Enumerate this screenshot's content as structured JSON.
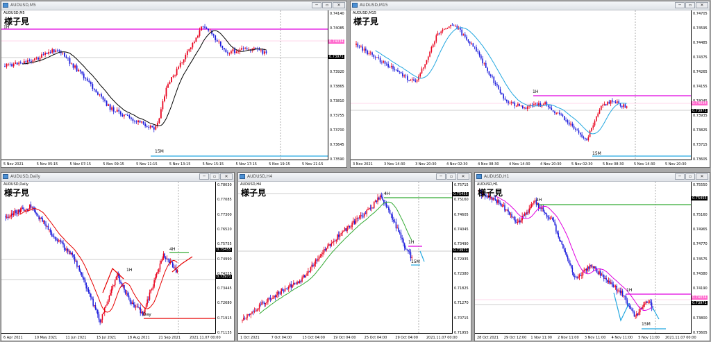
{
  "windows": [
    {
      "id": "w1",
      "title": "AUDUSD,M5",
      "symbol_line": "AUDUSD,M5",
      "note": "様子見",
      "y_ticks": [
        "0.74140",
        "0.74085",
        "0.74030",
        "0.73975",
        "0.73920",
        "0.73865",
        "0.73810",
        "0.73755",
        "0.73700",
        "0.73645",
        "0.73590"
      ],
      "x_ticks": [
        "5 Nov 2021",
        "5 Nov 05:15",
        "5 Nov 07:15",
        "5 Nov 09:15",
        "5 Nov 11:15",
        "5 Nov 13:15",
        "5 Nov 15:15",
        "5 Nov 17:15",
        "5 Nov 19:15",
        "5 Nov 21:15"
      ],
      "price_tags": [
        {
          "text": "0.74034",
          "color": "#ff66cc"
        },
        {
          "text": "0.73971",
          "color": "#000000"
        }
      ],
      "annotations": [
        "1H",
        "15M"
      ]
    },
    {
      "id": "w2",
      "title": "AUDUSD,M15",
      "symbol_line": "AUDUSD,M15",
      "note": "様子見",
      "y_ticks": [
        "0.74705",
        "0.74595",
        "0.74485",
        "0.74375",
        "0.74265",
        "0.74155",
        "0.74045",
        "0.73935",
        "0.73825",
        "0.73715",
        "0.73605"
      ],
      "x_ticks": [
        "3 Nov 2021",
        "3 Nov 14:30",
        "3 Nov 20:30",
        "4 Nov 02:30",
        "4 Nov 08:30",
        "4 Nov 14:30",
        "4 Nov 20:30",
        "5 Nov 02:30",
        "5 Nov 08:30",
        "5 Nov 14:30",
        "5 Nov 20:30"
      ],
      "price_tags": [
        {
          "text": "0.74034",
          "color": "#ff66cc"
        },
        {
          "text": "0.73971",
          "color": "#000000"
        }
      ],
      "annotations": [
        "1H",
        "15M"
      ]
    },
    {
      "id": "w3",
      "title": "AUDUSD,Daily",
      "symbol_line": "AUDUSD,Daily",
      "note": "様子見",
      "y_ticks": [
        "0.78030",
        "0.77085",
        "0.77300",
        "0.76520",
        "0.75755",
        "0.74990",
        "0.74225",
        "0.73445",
        "0.72680",
        "0.71915",
        "0.71135"
      ],
      "x_ticks": [
        "6 Apr 2021",
        "10 May 2021",
        "11 Jun 2021",
        "15 Jul 2021",
        "18 Aug 2021",
        "21 Sep 2021",
        "2021.11.07 00:00"
      ],
      "price_tags": [
        {
          "text": "0.75455",
          "color": "#000000"
        },
        {
          "text": "0.73971",
          "color": "#000000"
        }
      ],
      "annotations": [
        "4H",
        "1H",
        "Day"
      ]
    },
    {
      "id": "w4",
      "title": "AUDUSD,H4",
      "symbol_line": "AUDUSD,H4",
      "note": "様子見",
      "y_ticks": [
        "0.75715",
        "0.75160",
        "0.74605",
        "0.74045",
        "0.73490",
        "0.72935",
        "0.72380",
        "0.71825",
        "0.71270",
        "0.70715",
        "0.71955"
      ],
      "x_ticks": [
        "1 Oct 2021",
        "7 Oct 04:00",
        "13 Oct 04:00",
        "19 Oct 04:00",
        "25 Oct 04:00",
        "29 Oct 04:00",
        "2021.11.07 00:00"
      ],
      "price_tags": [
        {
          "text": "0.75455",
          "color": "#000000"
        },
        {
          "text": "0.73971",
          "color": "#000000"
        }
      ],
      "annotations": [
        "4H",
        "1H",
        "15M"
      ]
    },
    {
      "id": "w5",
      "title": "AUDUSD,H1",
      "symbol_line": "AUDUSD,H1",
      "note": "様子見",
      "y_ticks": [
        "0.75550",
        "0.75355",
        "0.75160",
        "0.74965",
        "0.74770",
        "0.74575",
        "0.74380",
        "0.74190",
        "0.73995",
        "0.73800",
        "0.73605"
      ],
      "x_ticks": [
        "28 Oct 2021",
        "29 Oct 12:00",
        "1 Nov 11:00",
        "2 Nov 11:00",
        "3 Nov 11:00",
        "4 Nov 11:00",
        "5 Nov 11:00",
        "2021.11.07 00:00"
      ],
      "price_tags": [
        {
          "text": "0.75455",
          "color": "#000000"
        },
        {
          "text": "0.74034",
          "color": "#ff66cc"
        },
        {
          "text": "0.73971",
          "color": "#000000"
        }
      ],
      "annotations": [
        "4H",
        "1H",
        "15M"
      ]
    }
  ],
  "window_buttons": {
    "minimize": "─",
    "restore": "▫",
    "close": "✕"
  },
  "colors": {
    "bull": "#e8001c",
    "bear": "#1a1adb",
    "ma_m5": "#000000",
    "ma_m15": "#22a7e0",
    "ma_daily": "#e60000",
    "ma_h4": "#33aa33",
    "ma_h1": "#e000e0",
    "level_4h": "#33aa33",
    "level_1h": "#e000e0",
    "level_15m": "#22a7e0",
    "level_day": "#e60000"
  }
}
